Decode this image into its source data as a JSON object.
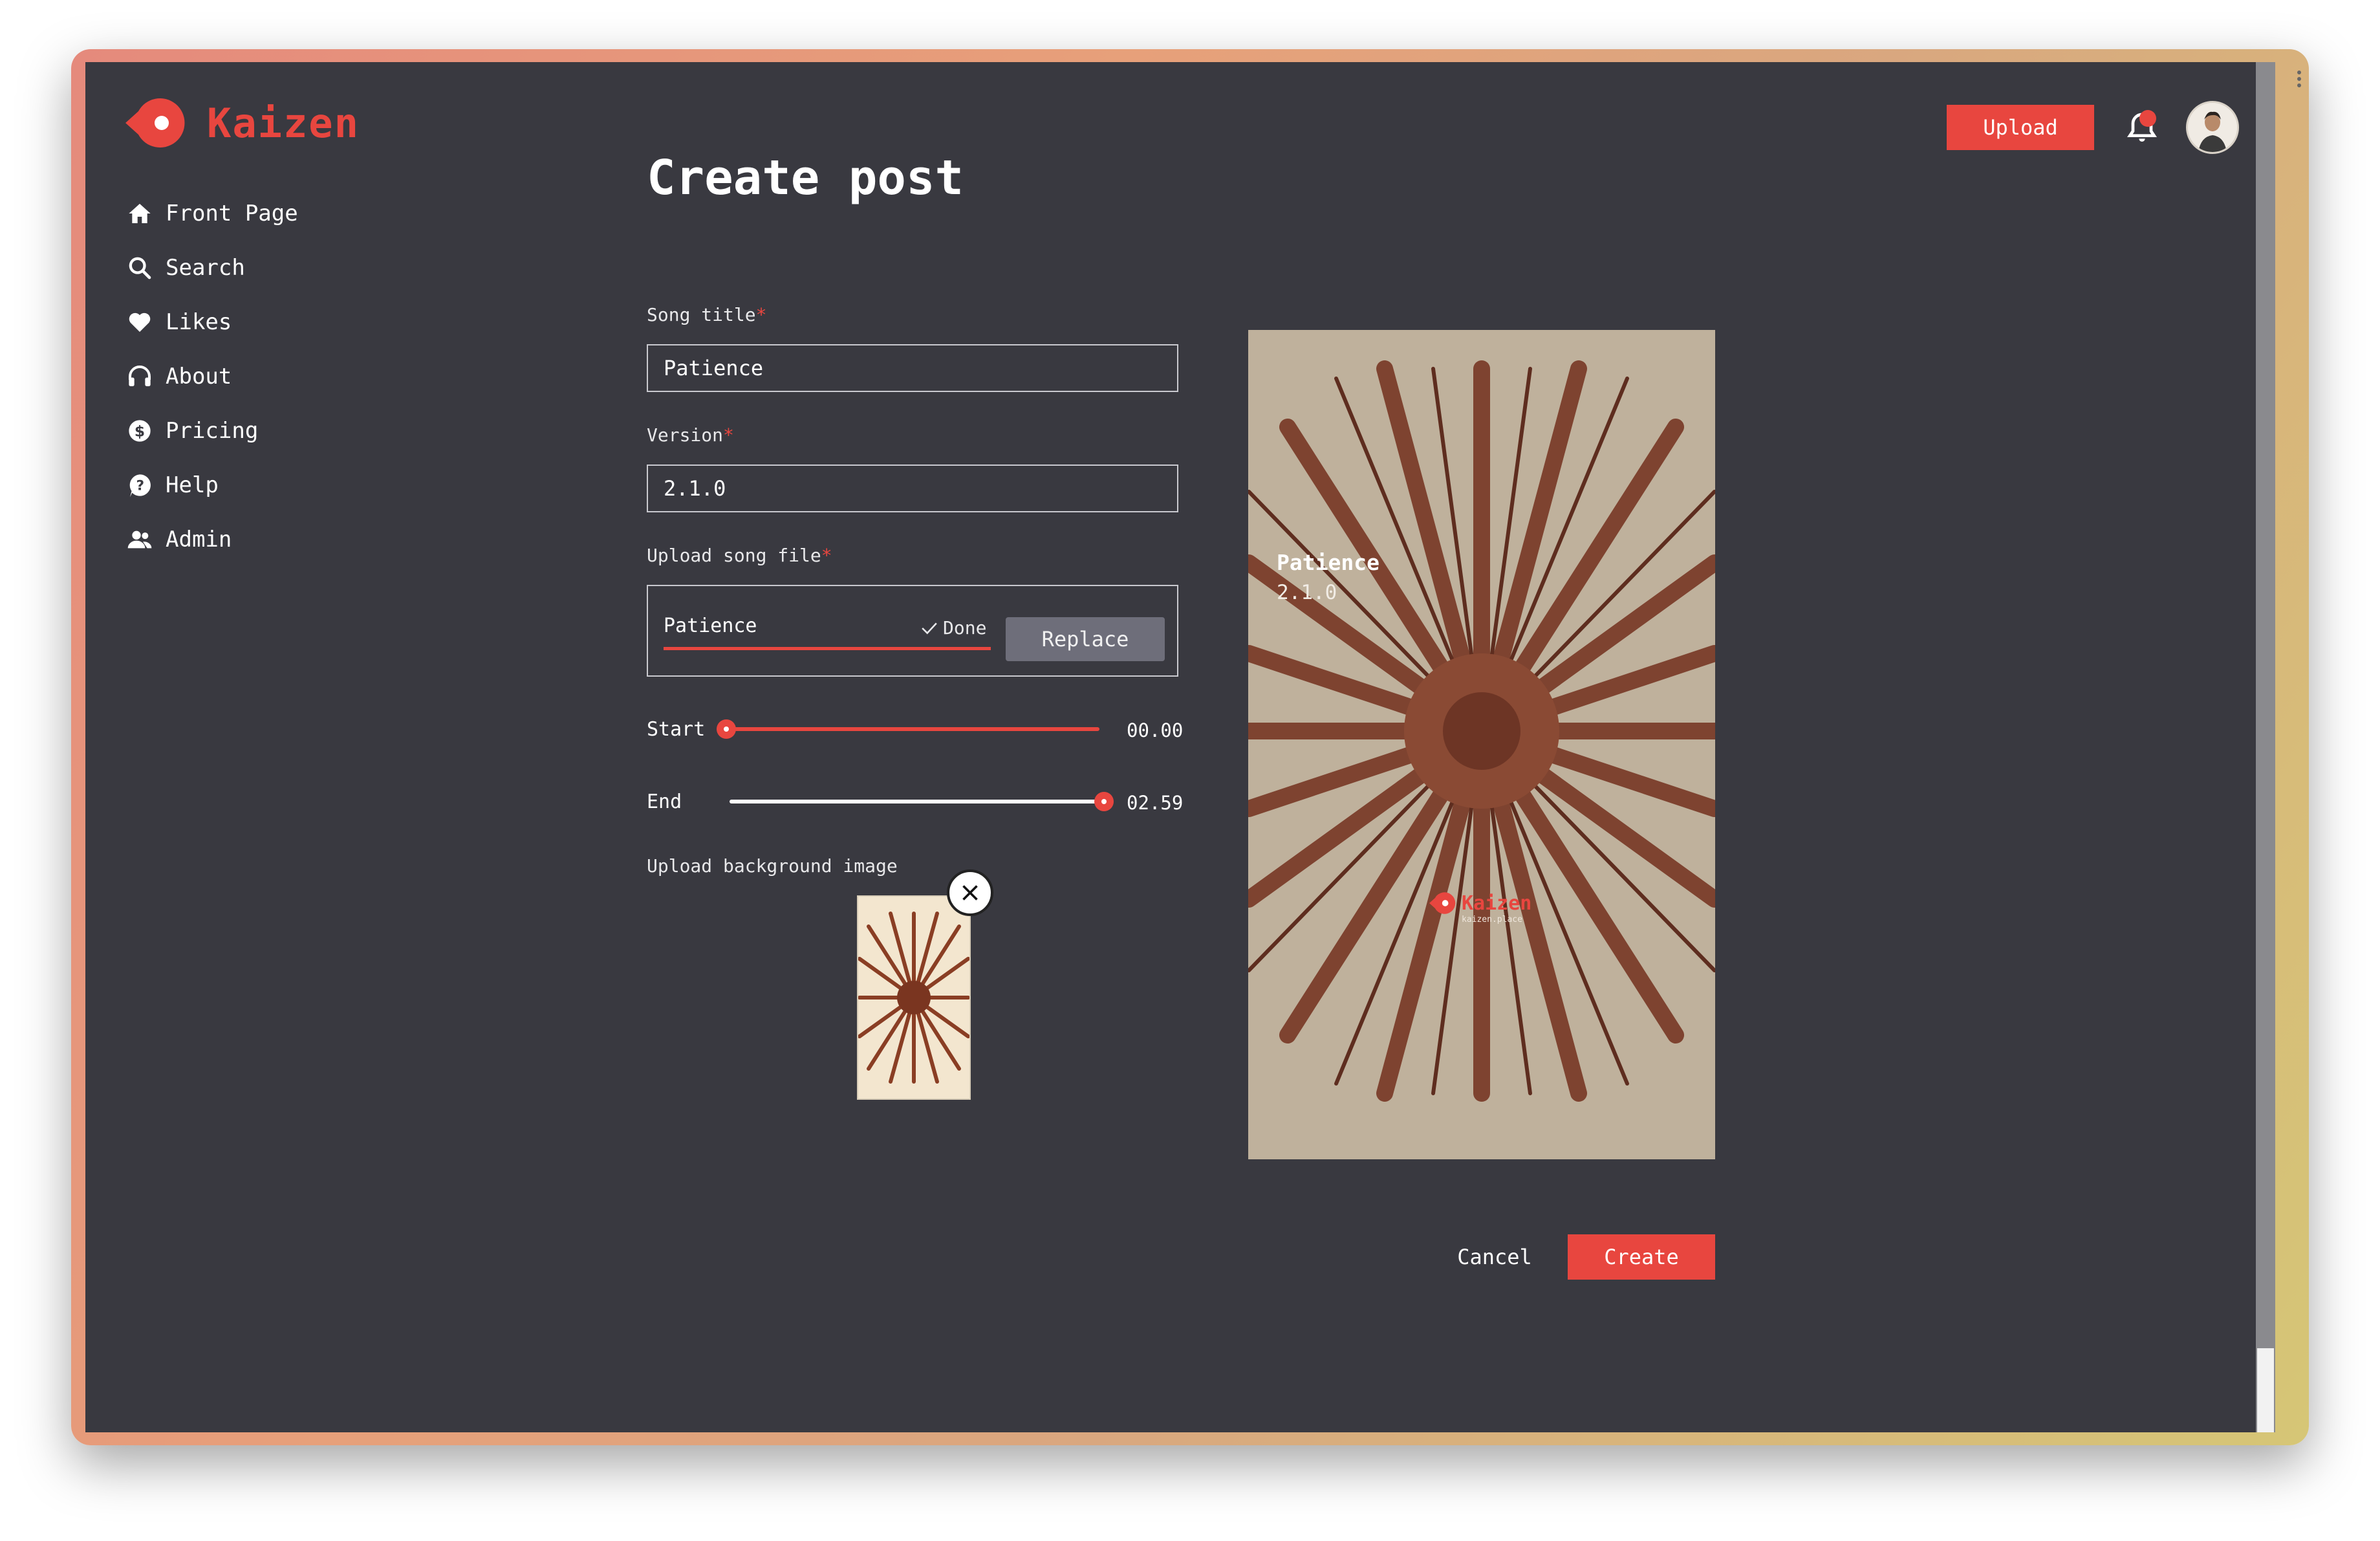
{
  "app": {
    "name": "Kaizen",
    "accent": "#e8463f",
    "background": "#393940"
  },
  "header": {
    "upload_label": "Upload",
    "notification_unread": true
  },
  "sidebar": {
    "items": [
      {
        "label": "Front Page",
        "icon": "home-icon"
      },
      {
        "label": "Search",
        "icon": "search-icon"
      },
      {
        "label": "Likes",
        "icon": "heart-icon"
      },
      {
        "label": "About",
        "icon": "headphones-icon"
      },
      {
        "label": "Pricing",
        "icon": "dollar-icon"
      },
      {
        "label": "Help",
        "icon": "help-icon"
      },
      {
        "label": "Admin",
        "icon": "users-icon"
      }
    ]
  },
  "main": {
    "title": "Create post",
    "form": {
      "song_title": {
        "label": "Song title",
        "required_mark": "*",
        "value": "Patience"
      },
      "version": {
        "label": "Version",
        "required_mark": "*",
        "value": "2.1.0"
      },
      "song_file": {
        "label": "Upload song file",
        "required_mark": "*",
        "file_name": "Patience",
        "status": "Done",
        "progress": 1.0,
        "replace_label": "Replace"
      },
      "start": {
        "label": "Start",
        "value": "00.00",
        "fraction": 0.0
      },
      "end": {
        "label": "End",
        "value": "02.59",
        "fraction": 1.0
      },
      "background_image": {
        "label": "Upload background image"
      }
    },
    "preview": {
      "title": "Patience",
      "version": "2.1.0",
      "watermark": "Kaizen",
      "watermark_sub": "kaizen.place"
    },
    "actions": {
      "cancel_label": "Cancel",
      "create_label": "Create"
    }
  }
}
